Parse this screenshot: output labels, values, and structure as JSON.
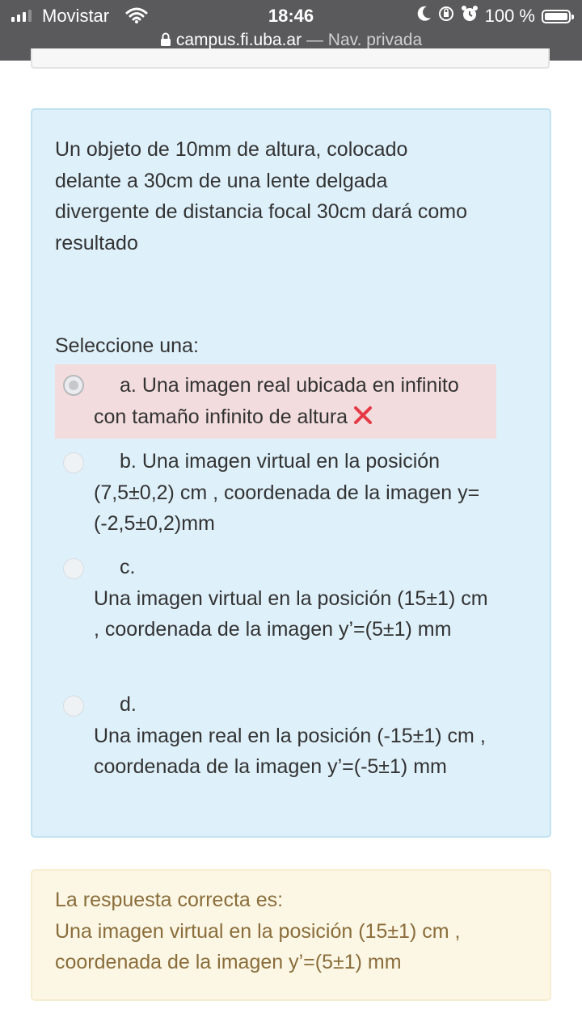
{
  "status_bar": {
    "carrier": "Movistar",
    "time": "18:46",
    "battery": "100 %"
  },
  "browser": {
    "domain": "campus.fi.uba.ar",
    "separator": "—",
    "mode": "Nav. privada"
  },
  "question": {
    "text": "Un objeto de 10mm de altura, colocado delante a 30cm de una lente delgada divergente de distancia focal 30cm dará como resultado",
    "prompt": "Seleccione una:",
    "options": [
      {
        "letter": "a.",
        "text": "Una imagen real ubicada en infinito con tamaño infinito de altura",
        "selected": true,
        "status": "incorrect"
      },
      {
        "letter": "b.",
        "text": "Una imagen virtual en la posición (7,5±0,2) cm , coordenada de la imagen y= (-2,5±0,2)mm",
        "selected": false
      },
      {
        "letter": "c.",
        "text": "Una imagen virtual en la posición (15±1) cm , coordenada  de la imagen y’=(5±1) mm",
        "selected": false
      },
      {
        "letter": "d.",
        "text": "Una imagen real en la posición (-15±1) cm , coordenada de la imagen y’=(-5±1) mm",
        "selected": false
      }
    ]
  },
  "feedback": {
    "heading": "La respuesta correcta es:",
    "answer": "Una imagen virtual en la posición (15±1) cm , coordenada  de la imagen y’=(5±1) mm"
  },
  "colors": {
    "question_bg": "#def0fa",
    "incorrect_bg": "#f2dcdd",
    "feedback_bg": "#fcf7e5",
    "feedback_text": "#8a6d3b",
    "cross": "#e63946"
  },
  "icons": [
    "signal-icon",
    "wifi-icon",
    "moon-icon",
    "orientation-lock-icon",
    "alarm-icon",
    "battery-icon",
    "lock-icon",
    "incorrect-cross-icon",
    "radio-icon"
  ]
}
